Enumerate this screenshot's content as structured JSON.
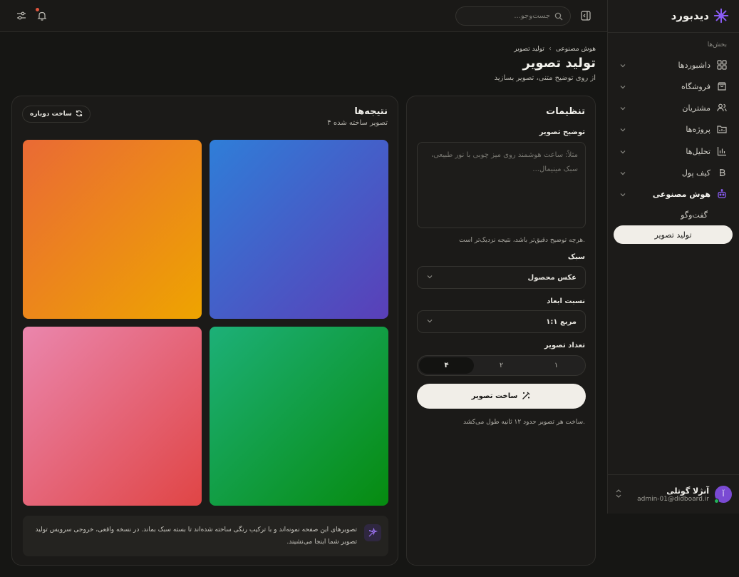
{
  "brand": {
    "name": "دیدبورد"
  },
  "search": {
    "placeholder": "جست‌وجو..."
  },
  "sidebar": {
    "section_title": "بخش‌ها",
    "items": [
      {
        "label": "داشبوردها",
        "icon": "dashboard-icon"
      },
      {
        "label": "فروشگاه",
        "icon": "shop-icon"
      },
      {
        "label": "مشتریان",
        "icon": "users-icon"
      },
      {
        "label": "پروژه‌ها",
        "icon": "folder-icon"
      },
      {
        "label": "تحلیل‌ها",
        "icon": "chart-icon"
      },
      {
        "label": "کیف پول",
        "icon": "bitcoin-icon"
      },
      {
        "label": "هوش مصنوعی",
        "icon": "robot-icon"
      }
    ],
    "sub_items": [
      {
        "label": "گفت‌وگو"
      },
      {
        "label": "تولید تصویر"
      }
    ]
  },
  "user": {
    "initial": "آ",
    "name": "آنژلا گوتلی",
    "email": "admin-01@didboard.ir"
  },
  "breadcrumb": {
    "parent": "هوش مصنوعی",
    "separator": "›",
    "current": "تولید تصویر"
  },
  "page": {
    "title": "تولید تصویر",
    "subtitle": "از روی توضیح متنی، تصویر بسازید"
  },
  "settings": {
    "title": "تنظیمات",
    "description_label": "توضیح تصویر",
    "description_placeholder": "مثلاً: ساعت هوشمند روی میز چوبی با نور طبیعی، سبک مینیمال...",
    "description_hint": "هرچه توضیح دقیق‌تر باشد، نتیجه نزدیک‌تر است.",
    "style_label": "سبک",
    "style_value": "عکس محصول",
    "ratio_label": "نسبت ابعاد",
    "ratio_value": "مربع ۱:۱",
    "count_label": "تعداد تصویر",
    "count_options": [
      "۱",
      "۲",
      "۴"
    ],
    "count_selected": "۴",
    "generate_label": "ساخت تصویر",
    "generate_note": "ساخت هر تصویر حدود ۱۲ ثانیه طول می‌کشد."
  },
  "results": {
    "title": "نتیجه‌ها",
    "count_text": "۴ تصویر ساخته شده",
    "regenerate_label": "ساخت دوباره",
    "images": [
      {
        "gradient": [
          "#2f7ed8",
          "#5a3fb8"
        ]
      },
      {
        "gradient": [
          "#ea6a35",
          "#eea400"
        ]
      },
      {
        "gradient": [
          "#1db078",
          "#068b0f"
        ]
      },
      {
        "gradient": [
          "#ea86ad",
          "#e04545"
        ]
      }
    ],
    "notice": "تصویرهای این صفحه نمونه‌اند و با ترکیب رنگی ساخته شده‌اند تا بسته سبک بماند. در نسخه واقعی، خروجی سرویس تولید تصویر شما اینجا می‌نشیند."
  },
  "colors": {
    "accent": "#8a5cf5",
    "background": "#161614",
    "panel": "#1b1a18",
    "primary_button": "#f1eee8"
  }
}
